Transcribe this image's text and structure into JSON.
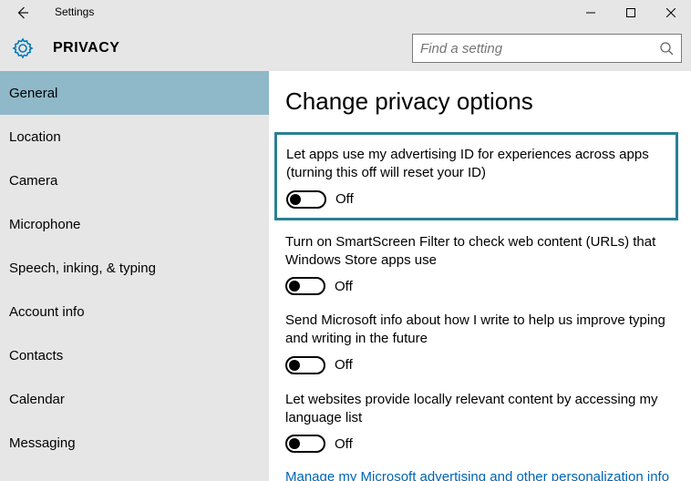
{
  "window": {
    "title": "Settings"
  },
  "header": {
    "section_title": "PRIVACY",
    "search_placeholder": "Find a setting"
  },
  "sidebar": {
    "items": [
      {
        "label": "General",
        "selected": true
      },
      {
        "label": "Location",
        "selected": false
      },
      {
        "label": "Camera",
        "selected": false
      },
      {
        "label": "Microphone",
        "selected": false
      },
      {
        "label": "Speech, inking, & typing",
        "selected": false
      },
      {
        "label": "Account info",
        "selected": false
      },
      {
        "label": "Contacts",
        "selected": false
      },
      {
        "label": "Calendar",
        "selected": false
      },
      {
        "label": "Messaging",
        "selected": false
      }
    ]
  },
  "main": {
    "heading": "Change privacy options",
    "options": [
      {
        "label": "Let apps use my advertising ID for experiences across apps (turning this off will reset your ID)",
        "state": "Off",
        "highlighted": true
      },
      {
        "label": "Turn on SmartScreen Filter to check web content (URLs) that Windows Store apps use",
        "state": "Off",
        "highlighted": false
      },
      {
        "label": "Send Microsoft info about how I write to help us improve typing and writing in the future",
        "state": "Off",
        "highlighted": false
      },
      {
        "label": "Let websites provide locally relevant content by accessing my language list",
        "state": "Off",
        "highlighted": false
      }
    ],
    "link": "Manage my Microsoft advertising and other personalization info"
  }
}
